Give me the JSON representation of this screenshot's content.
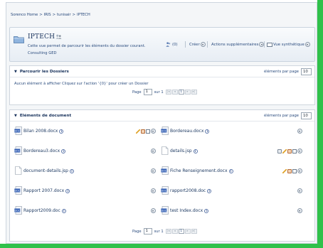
{
  "breadcrumb": [
    "Sorenco Home",
    ">",
    "IRIS",
    ">",
    "tunisair",
    ">",
    "IPTECH"
  ],
  "header": {
    "title": "IPTECH",
    "description": "Cette vue permet de parcourir les éléments du dossier courant.",
    "subtitle": "Consulting GED",
    "people_count": "(0)",
    "create_label": "Créer",
    "more_actions_label": "Actions supplémentaires",
    "view_label": "Vue synthétique"
  },
  "folders_panel": {
    "title": "Parcourir les Dossiers",
    "per_page_label": "éléments par page",
    "per_page_value": "10",
    "empty_message": "Aucun élément à afficher Cliquez sur l'action '{0}' pour créer un Dossier",
    "pager": {
      "page_label": "Page",
      "page_value": "1",
      "of_label": "sur 1",
      "current": "1"
    }
  },
  "documents_panel": {
    "title": "Eléments de document",
    "per_page_label": "éléments par page",
    "per_page_value": "10",
    "pager": {
      "page_label": "Page",
      "page_value": "1",
      "of_label": "sur 1",
      "current": "1"
    },
    "documents": [
      {
        "name": "Bilan 2008.docx",
        "icon": "word-doc-icon"
      },
      {
        "name": "Bordereau.docx",
        "icon": "word-doc-icon"
      },
      {
        "name": "Bordereau3.docx",
        "icon": "word-doc-icon"
      },
      {
        "name": "details.jsp",
        "icon": "blank-file-icon"
      },
      {
        "name": "document-details.jsp",
        "icon": "blank-file-icon"
      },
      {
        "name": "Fiche Renseignement.docx",
        "icon": "word-doc-icon"
      },
      {
        "name": "Rapport 2007.docx",
        "icon": "word-doc-icon"
      },
      {
        "name": "rapport2008.doc",
        "icon": "word-doc-icon"
      },
      {
        "name": "Rapport2009.doc",
        "icon": "word-doc-icon"
      },
      {
        "name": "test Index.docx",
        "icon": "word-doc-icon"
      }
    ]
  },
  "colors": {
    "accent_green": "#2fc14a",
    "title_navy": "#16305a",
    "link_blue": "#2b4c7e"
  }
}
